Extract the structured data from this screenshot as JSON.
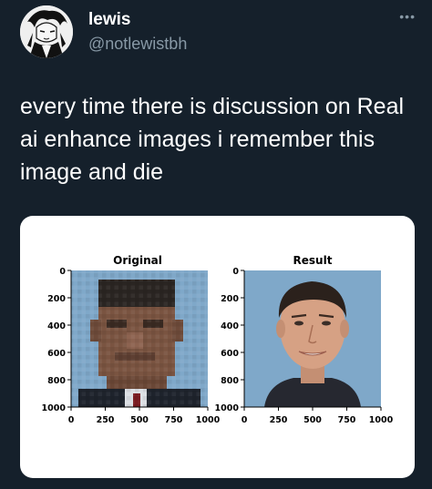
{
  "tweet": {
    "author_name": "lewis",
    "author_handle": "@notlewistbh",
    "text": "every time there is discussion on Real ai enhance images i remember this image and die"
  },
  "media": {
    "panels": [
      {
        "title": "Original",
        "y_ticks": [
          "0",
          "200",
          "400",
          "600",
          "800",
          "1000"
        ],
        "x_ticks": [
          "0",
          "250",
          "500",
          "750",
          "1000"
        ]
      },
      {
        "title": "Result",
        "y_ticks": [
          "0",
          "200",
          "400",
          "600",
          "800",
          "1000"
        ],
        "x_ticks": [
          "0",
          "250",
          "500",
          "750",
          "1000"
        ]
      }
    ]
  },
  "icons": {
    "more": "more-horizontal-icon",
    "more_glyph": "•••"
  }
}
